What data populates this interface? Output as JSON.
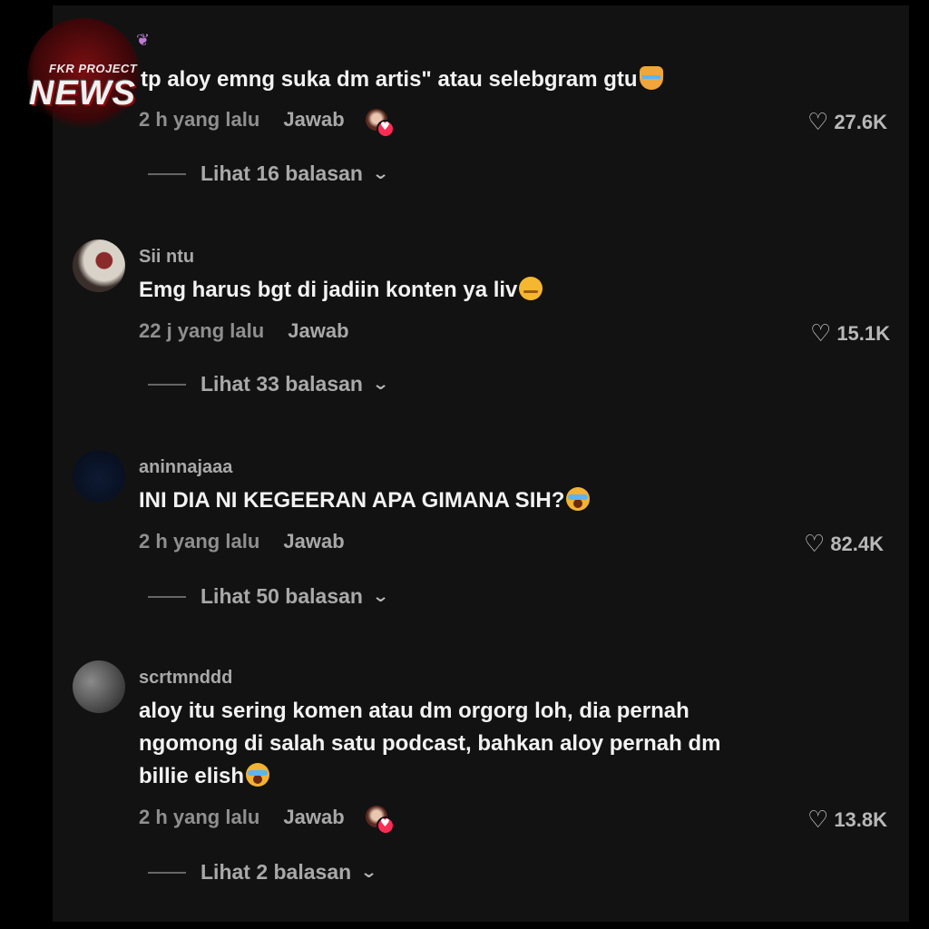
{
  "watermark": {
    "brand_small": "FKR PROJECT",
    "brand_large": "NEWS"
  },
  "comments": [
    {
      "id": "c1",
      "text": "tp aloy emng suka dm artis\" atau selebgram gtu",
      "emoji": "crying-cat-emoji",
      "time": "2 h yang lalu",
      "reply_label": "Jawab",
      "creator_liked": true,
      "likes": "27.6K",
      "view_replies": "Lihat 16 balasan"
    },
    {
      "id": "c2",
      "username": "Sii ntu",
      "text": "Emg harus bgt di jadiin konten ya liv",
      "emoji": "pensive-face-emoji",
      "time": "22 j yang lalu",
      "reply_label": "Jawab",
      "creator_liked": false,
      "likes": "15.1K",
      "view_replies": "Lihat 33 balasan"
    },
    {
      "id": "c3",
      "username": "aninnajaaa",
      "text": "INI DIA NI KEGEERAN APA GIMANA SIH?",
      "emoji": "loudly-crying-face-emoji",
      "time": "2 h yang lalu",
      "reply_label": "Jawab",
      "creator_liked": false,
      "likes": "82.4K",
      "view_replies": "Lihat 50 balasan"
    },
    {
      "id": "c4",
      "username": "scrtmnddd",
      "text_lines": [
        "aloy itu sering komen atau dm orgorg loh, dia pernah",
        "ngomong di salah satu podcast, bahkan aloy pernah dm",
        "billie elish"
      ],
      "emoji": "loudly-crying-face-emoji",
      "time": "2 h yang lalu",
      "reply_label": "Jawab",
      "creator_liked": true,
      "likes": "13.8K",
      "view_replies": "Lihat 2 balasan"
    }
  ],
  "icons": {
    "like": "heart-outline-icon",
    "expand": "chevron-down-icon",
    "creator_like": "creator-liked-badge-icon"
  },
  "colors": {
    "background": "#121212",
    "text": "#f2f2f2",
    "muted": "#8f8f8f",
    "creator_heart": "#fe2c55"
  }
}
